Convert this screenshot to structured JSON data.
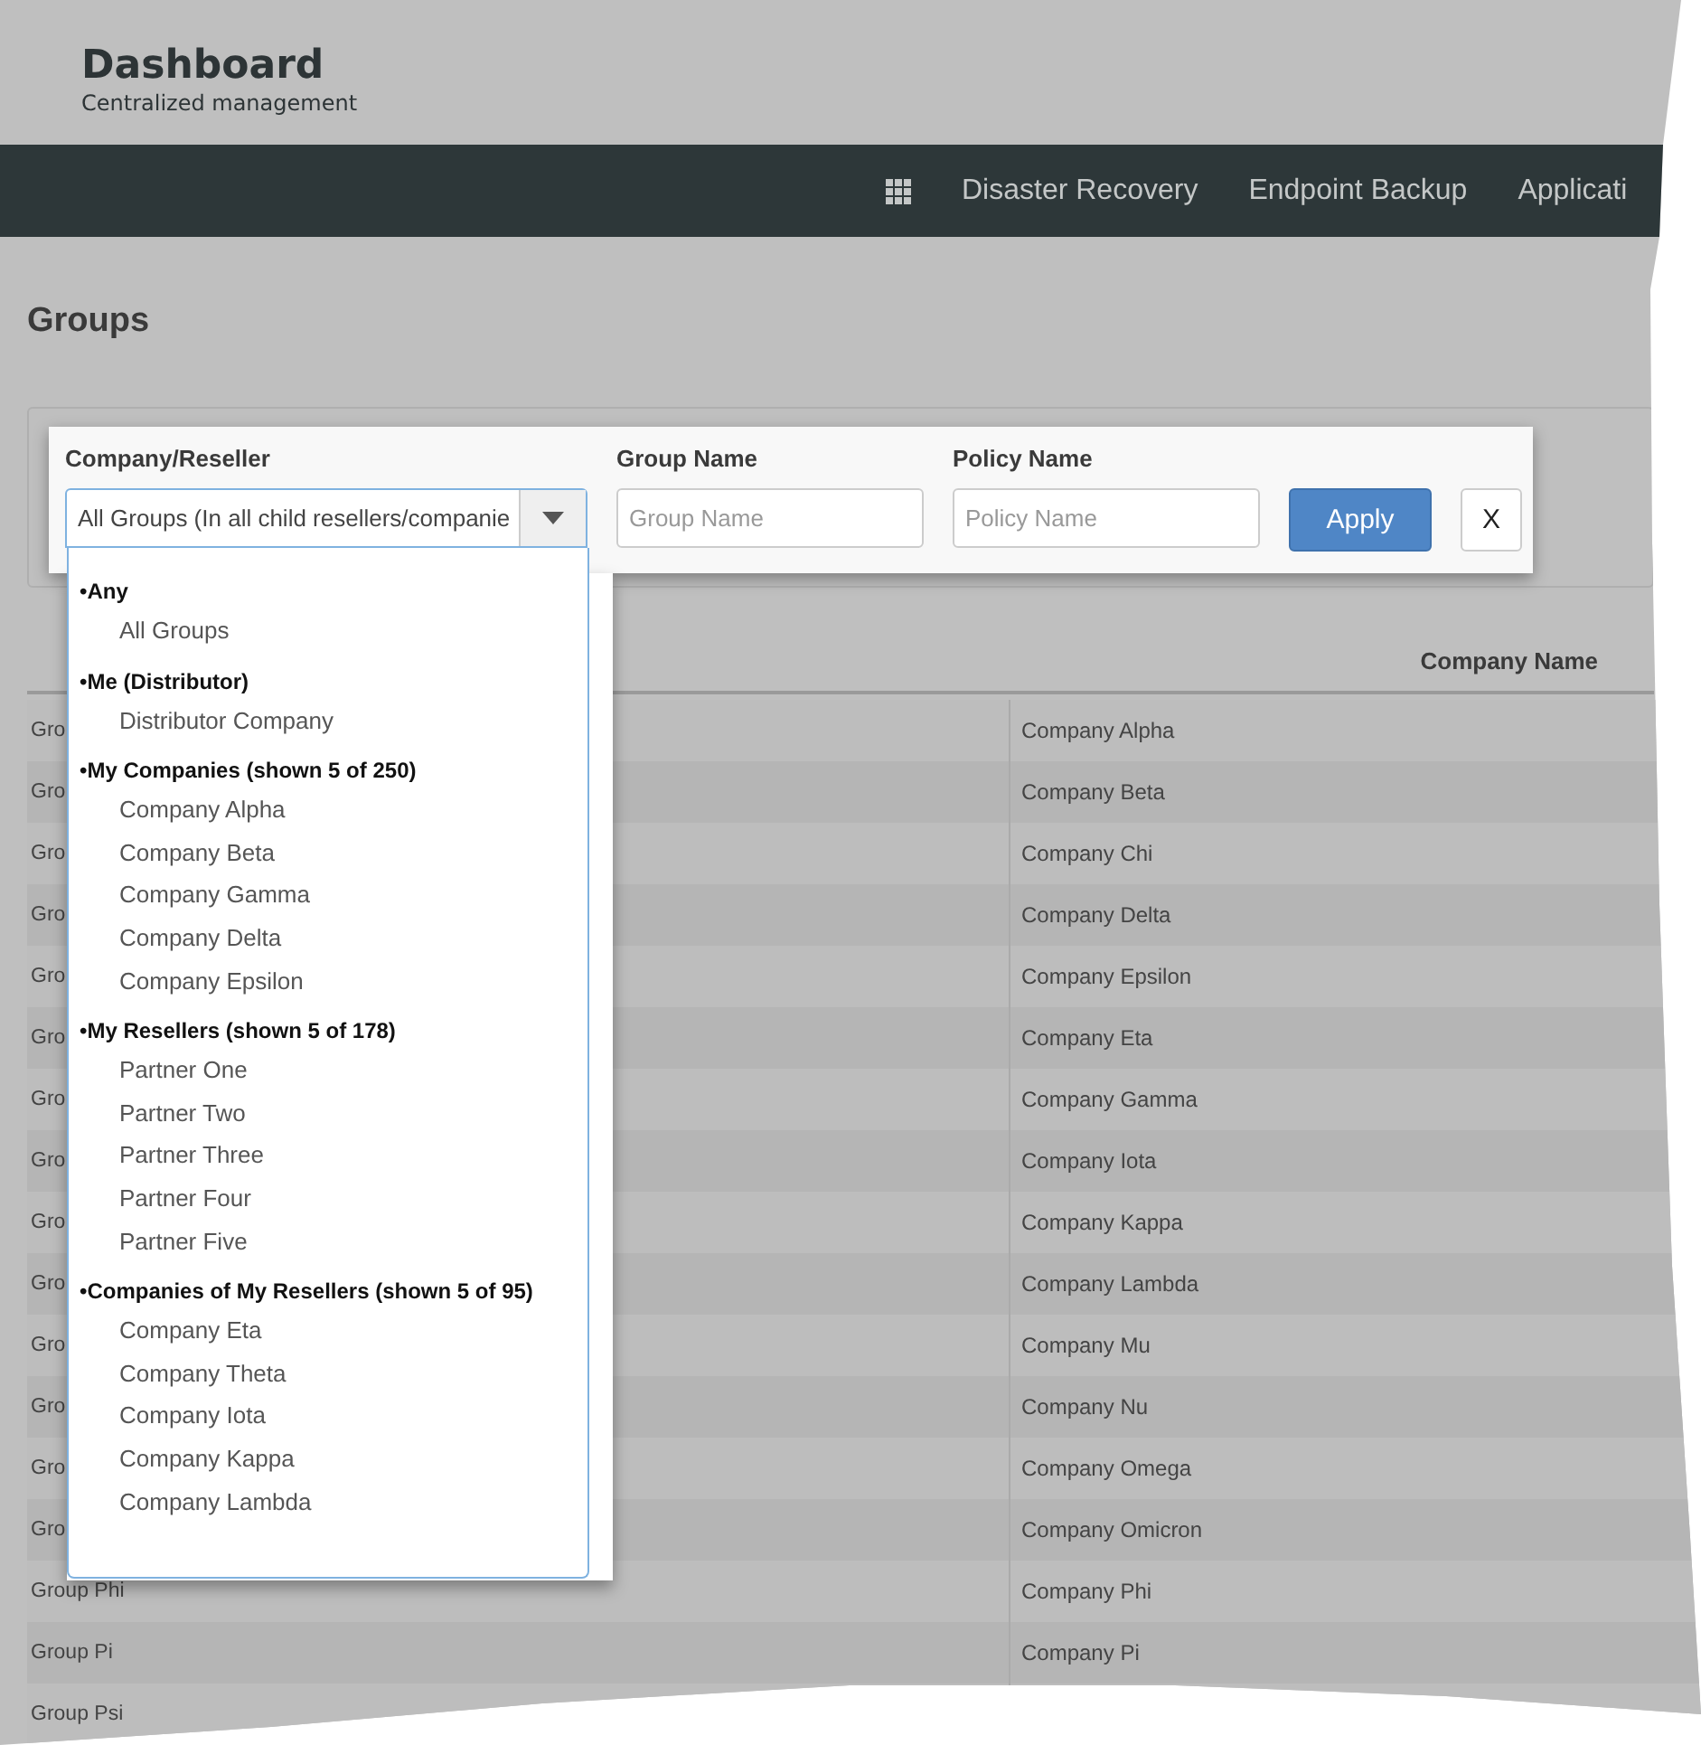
{
  "header": {
    "title": "Dashboard",
    "subtitle": "Centralized management"
  },
  "nav": {
    "items": [
      "Disaster Recovery",
      "Endpoint Backup",
      "Applicati"
    ]
  },
  "page_title": "Groups",
  "filters": {
    "fields": [
      {
        "kind": "select",
        "label": "Company/Reseller",
        "value": "All Groups (In all child resellers/companie",
        "expanded": true
      },
      {
        "kind": "input",
        "label": "Group Name",
        "placeholder": "Group Name"
      },
      {
        "kind": "input",
        "label": "Policy Name",
        "placeholder": "Policy Name"
      }
    ],
    "buttons": [
      {
        "kind": "primary",
        "label": "Apply"
      },
      {
        "kind": "secondary",
        "label": "X"
      }
    ]
  },
  "dropdown": {
    "groups": [
      {
        "label": "•Any",
        "options": [
          "All Groups"
        ]
      },
      {
        "label": "•Me (Distributor)",
        "options": [
          "Distributor Company"
        ]
      },
      {
        "label": "•My Companies (shown 5 of 250)",
        "options": [
          "Company Alpha",
          "Company Beta",
          "Company Gamma",
          "Company Delta",
          "Company Epsilon"
        ]
      },
      {
        "label": "•My Resellers (shown 5 of 178)",
        "options": [
          "Partner One",
          "Partner Two",
          "Partner Three",
          "Partner Four",
          "Partner Five"
        ]
      },
      {
        "label": "•Companies of My Resellers (shown 5 of 95)",
        "options": [
          "Company Eta",
          "Company Theta",
          "Company Iota",
          "Company Kappa",
          "Company Lambda"
        ]
      }
    ]
  },
  "table": {
    "company_header": "Company Name",
    "rows": [
      {
        "column_1": "Gro",
        "company": "Company Alpha"
      },
      {
        "column_1": "Gro",
        "company": "Company Beta"
      },
      {
        "column_1": "Gro",
        "company": "Company Chi"
      },
      {
        "column_1": "Gro",
        "company": "Company Delta"
      },
      {
        "column_1": "Gro",
        "company": "Company Epsilon"
      },
      {
        "column_1": "Gro",
        "company": "Company Eta"
      },
      {
        "column_1": "Gro",
        "company": "Company Gamma"
      },
      {
        "column_1": "Gro",
        "company": "Company Iota"
      },
      {
        "column_1": "Gro",
        "company": "Company Kappa"
      },
      {
        "column_1": "Gro",
        "company": "Company Lambda"
      },
      {
        "column_1": "Gro",
        "company": "Company Mu"
      },
      {
        "column_1": "Gro",
        "company": "Company Nu"
      },
      {
        "column_1": "Gro",
        "company": "Company Omega"
      },
      {
        "column_1": "Gro",
        "company": "Company Omicron"
      },
      {
        "column_1": "Group Phi",
        "company": "Company Phi"
      },
      {
        "column_1": "Group Pi",
        "company": "Company Pi"
      },
      {
        "column_1": "Group Psi"
      }
    ]
  }
}
